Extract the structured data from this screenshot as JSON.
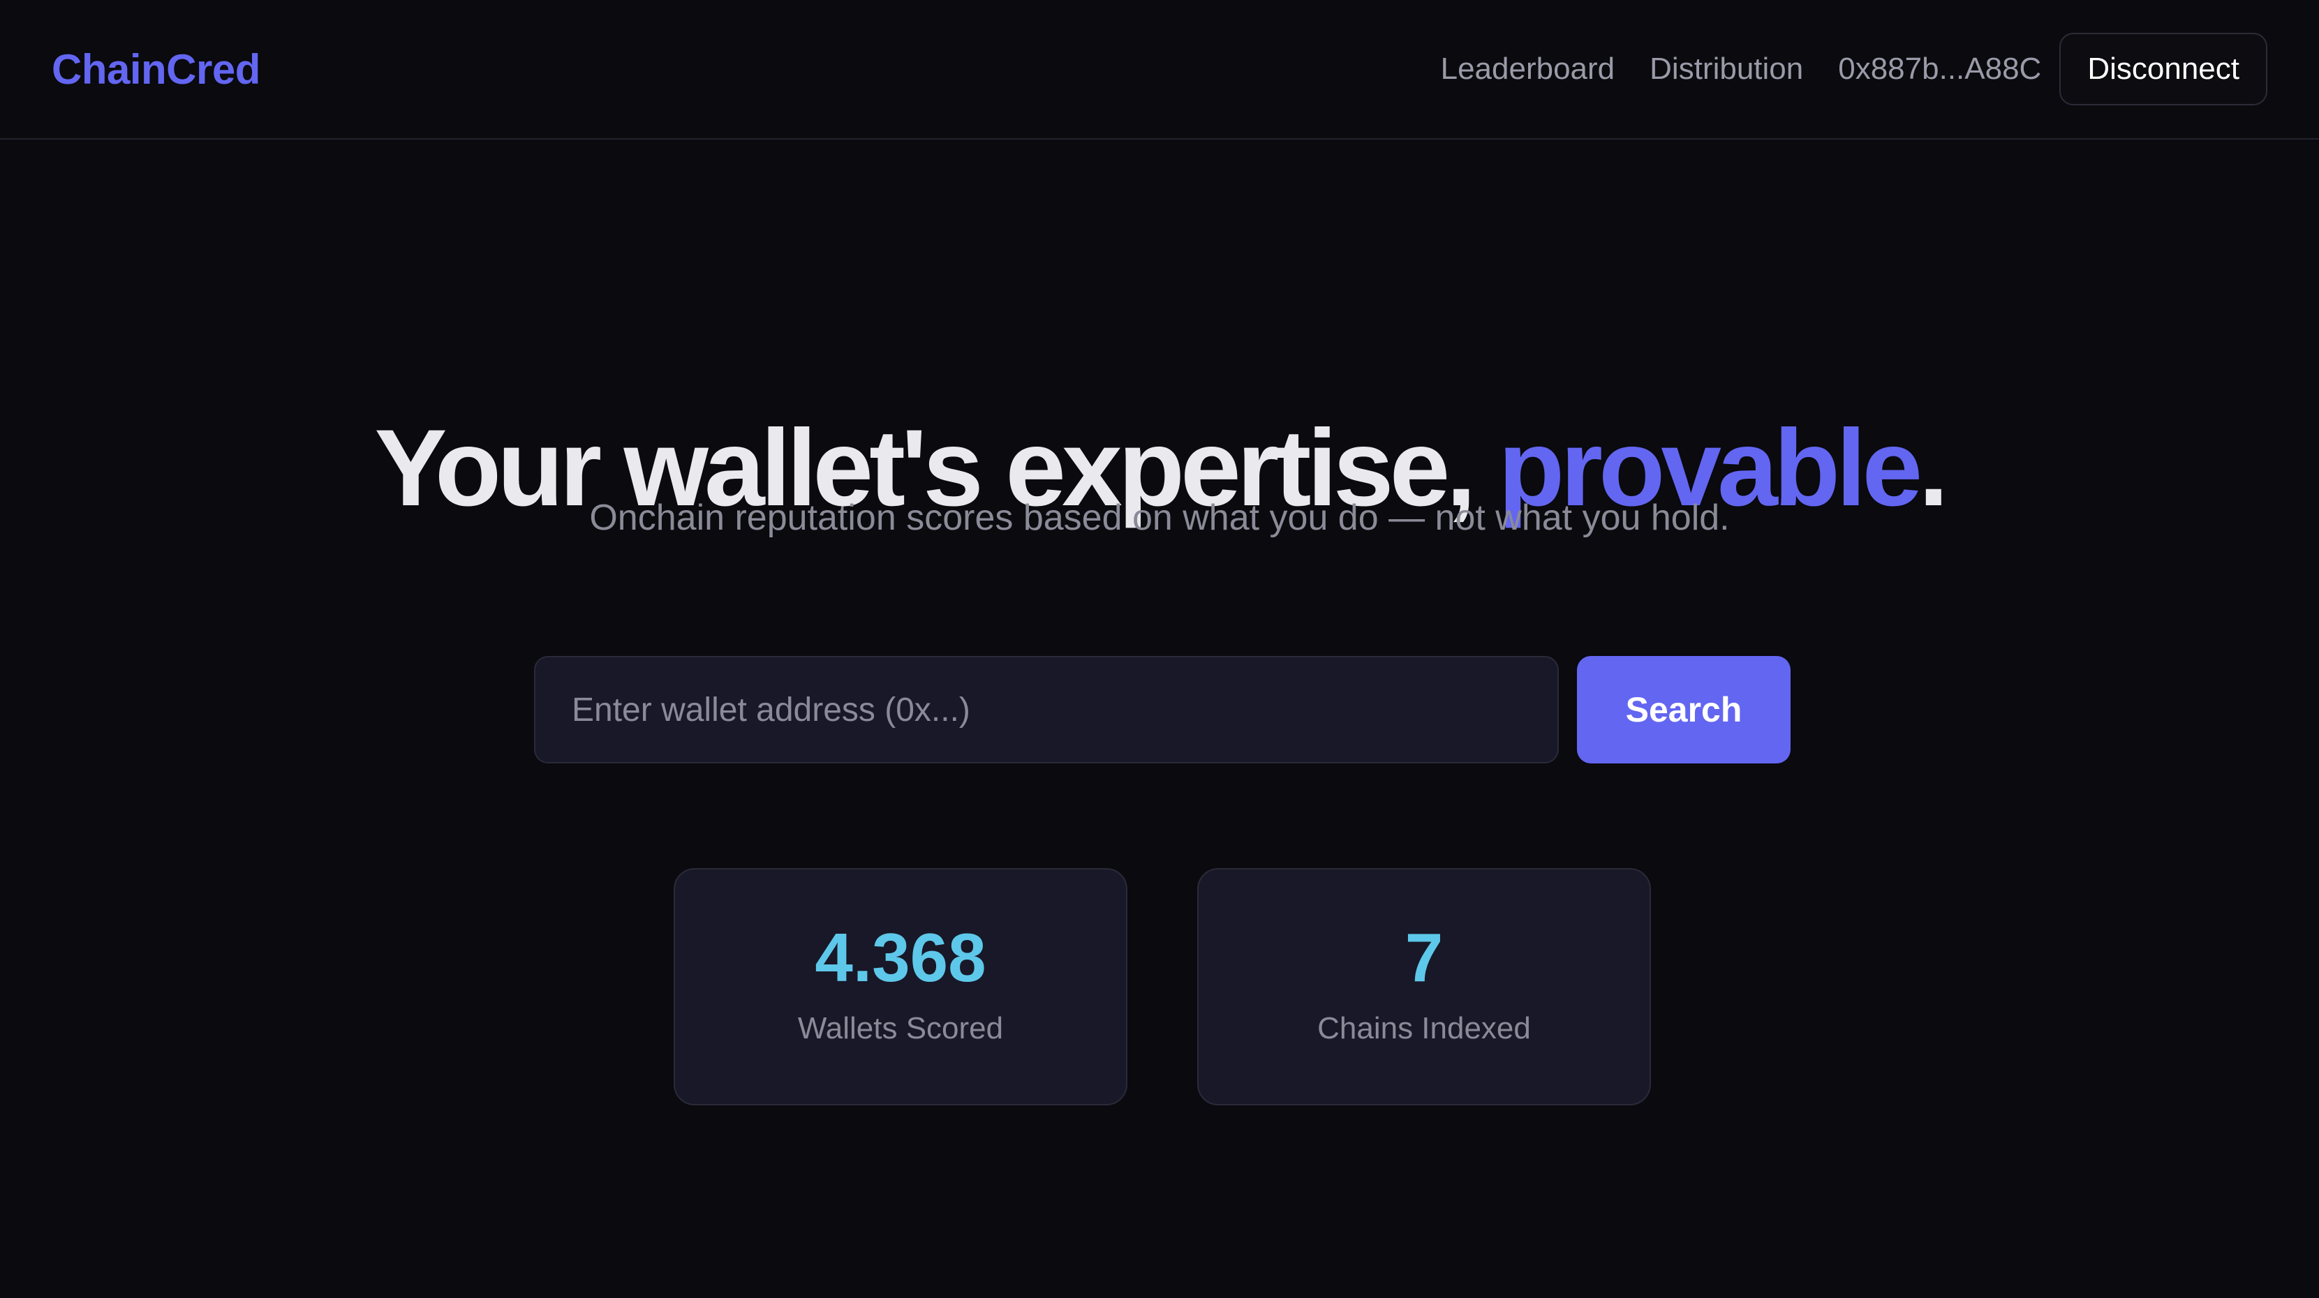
{
  "brand": "ChainCred",
  "nav": {
    "links": [
      "Leaderboard",
      "Distribution"
    ],
    "wallet_address": "0x887b...A88C",
    "disconnect_label": "Disconnect"
  },
  "hero": {
    "title_main": "Your wallet's expertise, ",
    "title_accent": "provable",
    "title_end": ".",
    "subtitle": "Onchain reputation scores based on what you do — not what you hold."
  },
  "search": {
    "placeholder": "Enter wallet address (0x...)",
    "value": "",
    "button_label": "Search"
  },
  "stats": [
    {
      "value": "4.368",
      "label": "Wallets Scored"
    },
    {
      "value": "7",
      "label": "Chains Indexed"
    }
  ],
  "colors": {
    "background": "#0a0a0f",
    "accent": "#6366f1",
    "stat_value": "#5ec8ea",
    "card": "#181828"
  }
}
